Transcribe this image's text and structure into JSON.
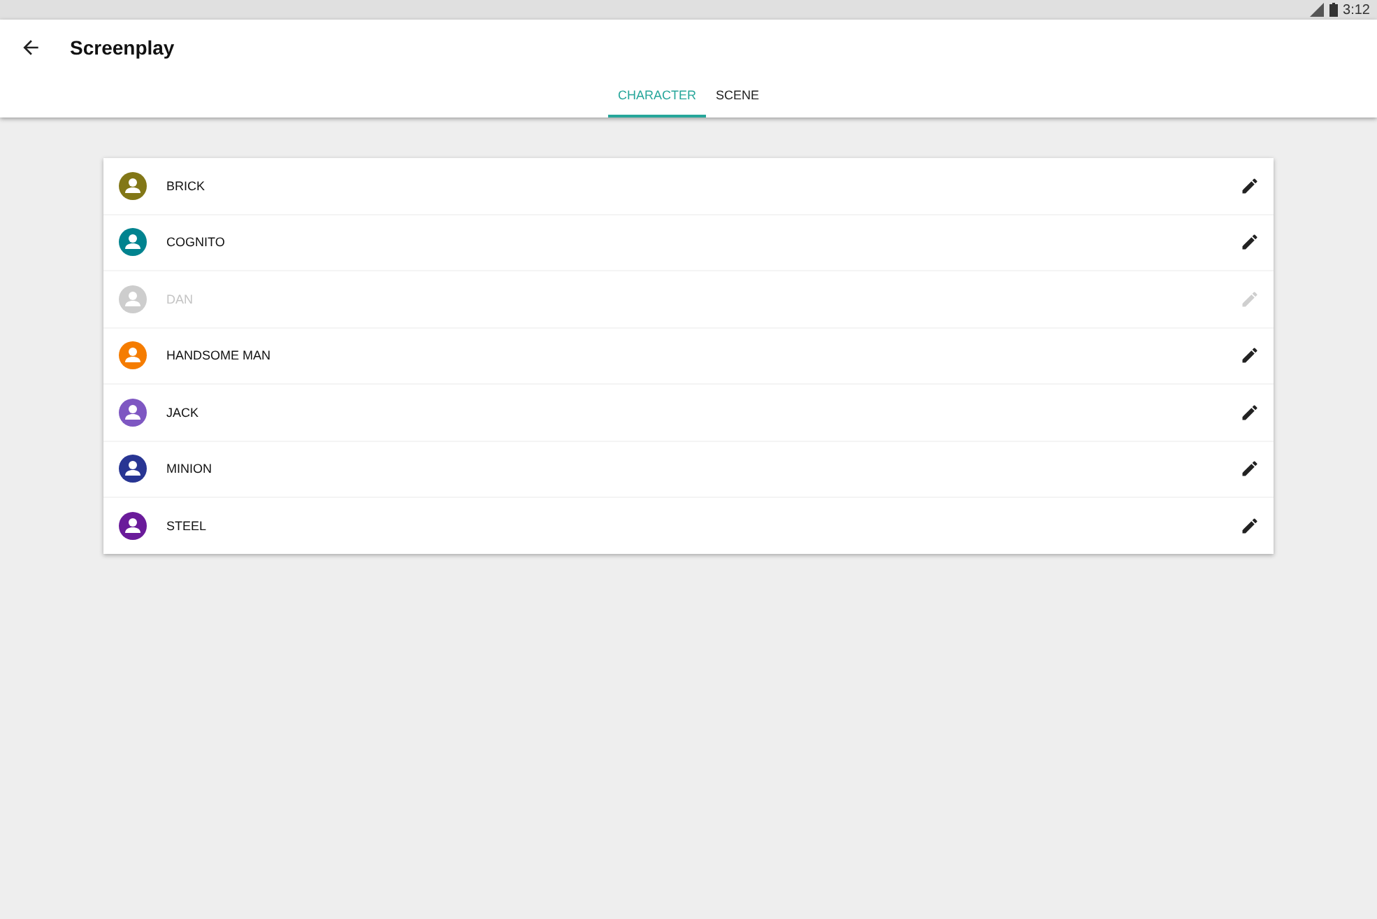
{
  "status_bar": {
    "time": "3:12"
  },
  "app_bar": {
    "title": "Screenplay"
  },
  "tabs": [
    {
      "label": "CHARACTER",
      "selected": true
    },
    {
      "label": "SCENE",
      "selected": false
    }
  ],
  "characters": [
    {
      "name": "BRICK",
      "color": "#827717",
      "disabled": false
    },
    {
      "name": "COGNITO",
      "color": "#00838f",
      "disabled": false
    },
    {
      "name": "DAN",
      "color": "#cdcdcd",
      "disabled": true
    },
    {
      "name": "HANDSOME MAN",
      "color": "#f57c00",
      "disabled": false
    },
    {
      "name": "JACK",
      "color": "#7e57c2",
      "disabled": false
    },
    {
      "name": "MINION",
      "color": "#283593",
      "disabled": false
    },
    {
      "name": "STEEL",
      "color": "#6a1b9a",
      "disabled": false
    }
  ]
}
